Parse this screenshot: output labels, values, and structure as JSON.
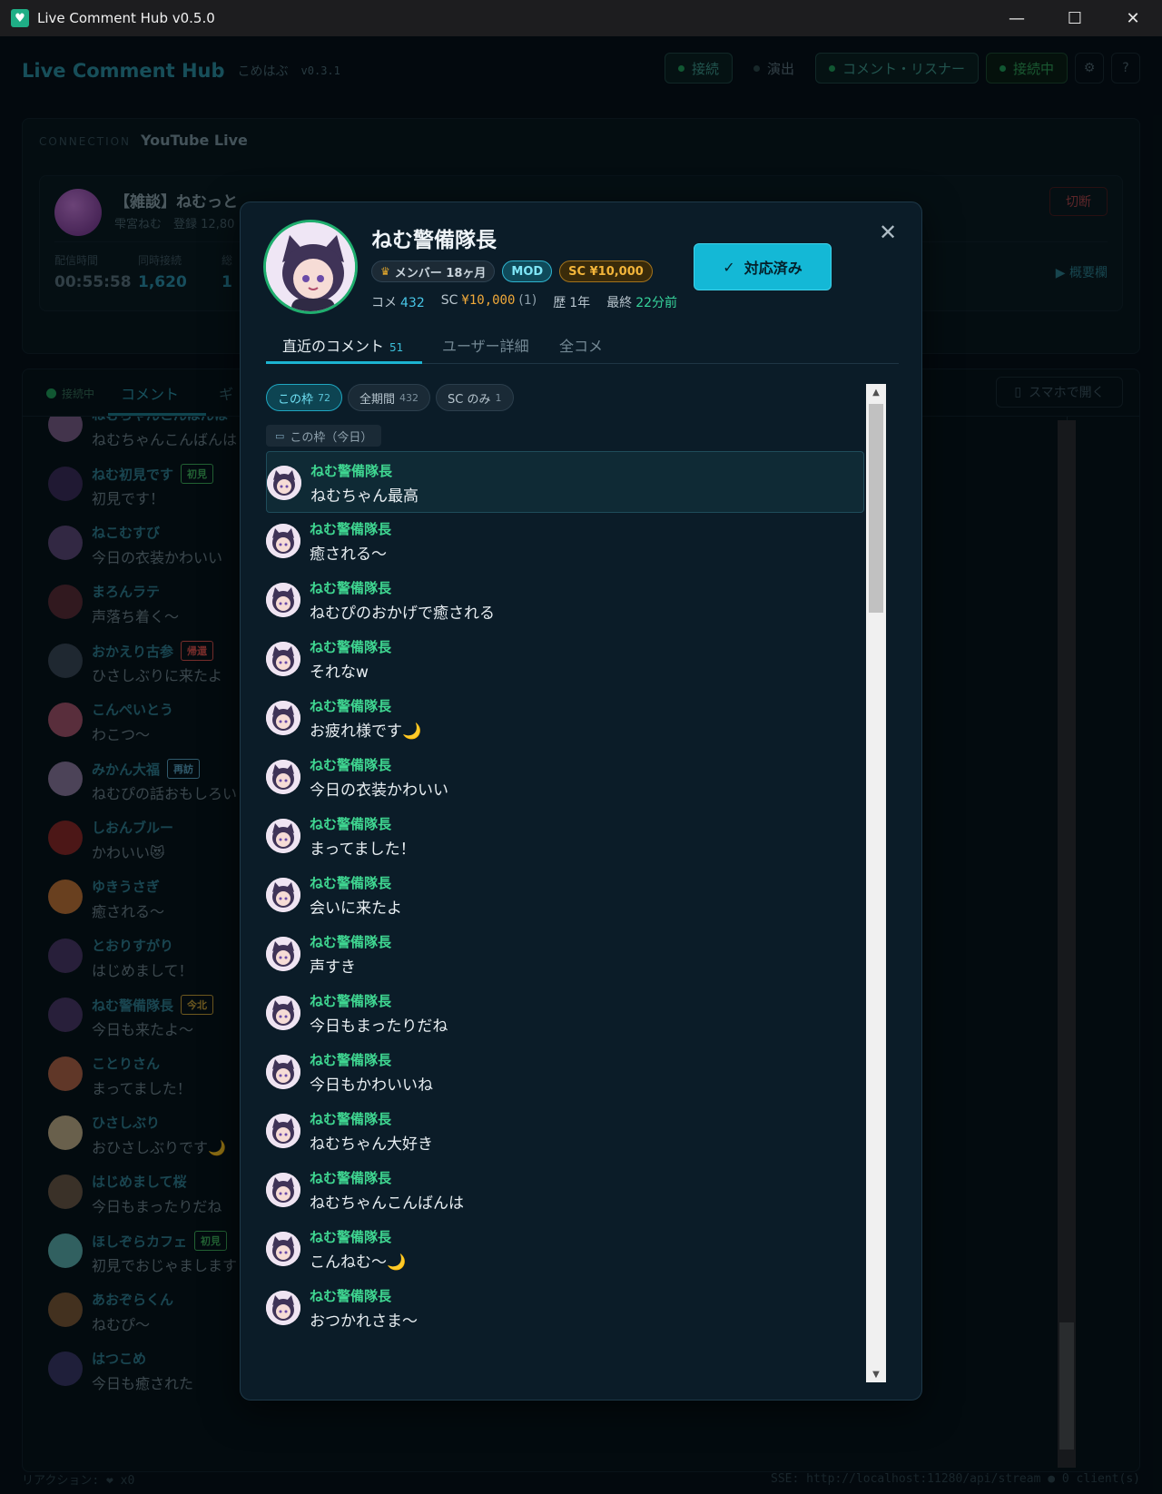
{
  "window": {
    "title": "Live Comment Hub v0.5.0",
    "app_icon": "heart-icon"
  },
  "header": {
    "brand": "Live Comment Hub",
    "brand_sub": "こめはぶ",
    "version": "v0.3.1",
    "nav": [
      {
        "label": "接続",
        "active": true
      },
      {
        "label": "演出",
        "active": false
      },
      {
        "label": "コメント・リスナー",
        "active": true
      }
    ],
    "status": "接続中",
    "settings_icon": "gear-icon",
    "help_icon": "?"
  },
  "connection": {
    "label": "CONNECTION",
    "source": "YouTube Live",
    "stream_title": "【雑談】ねむっと",
    "channel": "雫宮ねむ",
    "subscribers": "登録 12,80",
    "disconnect_label": "切断",
    "stats": [
      {
        "key": "配信時間",
        "value": "00:55:58"
      },
      {
        "key": "同時接続",
        "value": "1,620"
      },
      {
        "key": "総",
        "value": "1"
      }
    ],
    "overview_label": "▶ 概要欄"
  },
  "comments_panel": {
    "status": "接続中",
    "tabs": [
      "コメント",
      "ギ"
    ],
    "phone_button": "スマホで開く",
    "rows": [
      {
        "name": "ねむちゃんこんばんは",
        "tag": "",
        "tag_color": "",
        "text": "ねむちゃんこんばんは",
        "avatar_color": "#7a5f8a"
      },
      {
        "name": "ねむ初見です",
        "tag": "初見",
        "tag_color": "#3fb35e",
        "text": "初見です！",
        "avatar_color": "#3b2f5e"
      },
      {
        "name": "ねこむすび",
        "tag": "",
        "tag_color": "",
        "text": "今日の衣装かわいい",
        "avatar_color": "#5b4a7a"
      },
      {
        "name": "まろんラテ",
        "tag": "",
        "tag_color": "",
        "text": "声落ち着く〜",
        "avatar_color": "#5a2f3a"
      },
      {
        "name": "おかえり古参",
        "tag": "帰還",
        "tag_color": "#d9534f",
        "text": "ひさしぶりに来たよ",
        "avatar_color": "#3a4a5a"
      },
      {
        "name": "こんぺいとう",
        "tag": "",
        "tag_color": "",
        "text": "わこつ〜",
        "avatar_color": "#a3546e"
      },
      {
        "name": "みかん大福",
        "tag": "再訪",
        "tag_color": "#5aa7c7",
        "text": "ねむぴの話おもしろい",
        "avatar_color": "#8a7aa0"
      },
      {
        "name": "しおんブルー",
        "tag": "",
        "tag_color": "",
        "text": "かわいい😻",
        "avatar_color": "#8a2a2a"
      },
      {
        "name": "ゆきうさぎ",
        "tag": "",
        "tag_color": "",
        "text": "癒される〜",
        "avatar_color": "#c0763a"
      },
      {
        "name": "とおりすがり",
        "tag": "",
        "tag_color": "",
        "text": "はじめまして！",
        "avatar_color": "#4a3a6a"
      },
      {
        "name": "ねむ警備隊長",
        "tag": "今北",
        "tag_color": "#c9a33a",
        "text": "今日も来たよ〜",
        "avatar_color": "#4a3a6a"
      },
      {
        "name": "ことりさん",
        "tag": "",
        "tag_color": "",
        "text": "まってました！",
        "avatar_color": "#b0644a"
      },
      {
        "name": "ひさしぶり",
        "tag": "",
        "tag_color": "",
        "text": "おひさしぶりです🌙",
        "avatar_color": "#c0b08a"
      },
      {
        "name": "はじめまして桜",
        "tag": "",
        "tag_color": "",
        "text": "今日もまったりだね",
        "avatar_color": "#6a5a4a"
      },
      {
        "name": "ほしぞらカフェ",
        "tag": "初見",
        "tag_color": "#3fb35e",
        "text": "初見でおじゃまします",
        "avatar_color": "#5ab0b0"
      },
      {
        "name": "あおぞらくん",
        "tag": "",
        "tag_color": "",
        "text": "ねむぴ〜",
        "avatar_color": "#7a5a3a"
      },
      {
        "name": "はつこめ",
        "tag": "",
        "tag_color": "",
        "text": "今日も癒された",
        "avatar_color": "#3a3a6a"
      }
    ]
  },
  "footer": {
    "left": "リアクション: ❤ x0",
    "right": "SSE: http://localhost:11280/api/stream ● 0 client(s)"
  },
  "modal": {
    "user_name": "ねむ警備隊長",
    "badges": {
      "member": "メンバー 18ヶ月",
      "mod": "MOD",
      "sc": "SC ¥10,000"
    },
    "stats": {
      "comments_label": "コメ",
      "comments_value": "432",
      "sc_label": "SC",
      "sc_value": "¥10,000",
      "sc_count": "(1)",
      "history_label": "歴",
      "history_value": "1年",
      "last_label": "最終",
      "last_value": "22分前"
    },
    "done_button": "対応済み",
    "tabs": [
      {
        "label": "直近のコメント",
        "count": "51"
      },
      {
        "label": "ユーザー詳細",
        "count": ""
      },
      {
        "label": "全コメ",
        "count": ""
      }
    ],
    "chips": [
      {
        "label": "この枠",
        "count": "72"
      },
      {
        "label": "全期間",
        "count": "432"
      },
      {
        "label": "SC のみ",
        "count": "1"
      }
    ],
    "group_label": "この枠（今日）",
    "comments": [
      {
        "name": "ねむ警備隊長",
        "text": "ねむちゃん最高"
      },
      {
        "name": "ねむ警備隊長",
        "text": "癒される〜"
      },
      {
        "name": "ねむ警備隊長",
        "text": "ねむぴのおかげで癒される"
      },
      {
        "name": "ねむ警備隊長",
        "text": "それなw"
      },
      {
        "name": "ねむ警備隊長",
        "text": "お疲れ様です🌙"
      },
      {
        "name": "ねむ警備隊長",
        "text": "今日の衣装かわいい"
      },
      {
        "name": "ねむ警備隊長",
        "text": "まってました！"
      },
      {
        "name": "ねむ警備隊長",
        "text": "会いに来たよ"
      },
      {
        "name": "ねむ警備隊長",
        "text": "声すき"
      },
      {
        "name": "ねむ警備隊長",
        "text": "今日もまったりだね"
      },
      {
        "name": "ねむ警備隊長",
        "text": "今日もかわいいね"
      },
      {
        "name": "ねむ警備隊長",
        "text": "ねむちゃん大好き"
      },
      {
        "name": "ねむ警備隊長",
        "text": "ねむちゃんこんばんは"
      },
      {
        "name": "ねむ警備隊長",
        "text": "こんねむ〜🌙"
      },
      {
        "name": "ねむ警備隊長",
        "text": "おつかれさま〜"
      }
    ]
  }
}
